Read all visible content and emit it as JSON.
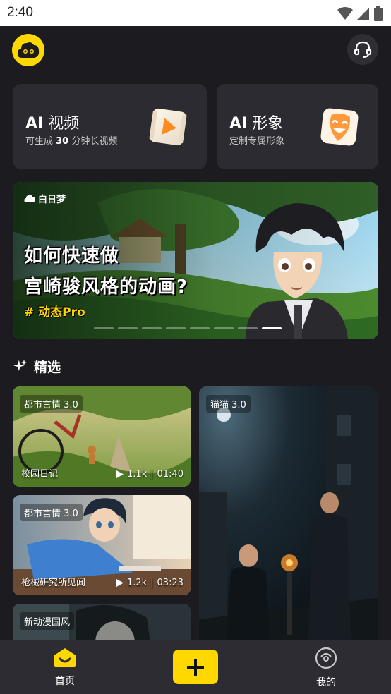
{
  "status": {
    "time": "2:40"
  },
  "header": {
    "logo_icon": "cloud-face-logo",
    "support_icon": "headset-icon"
  },
  "features": [
    {
      "title_prefix": "AI",
      "title_suffix": " 视频",
      "sub_a": "可生成 ",
      "sub_num": "30",
      "sub_b": " 分钟长视频",
      "icon": "play-icon"
    },
    {
      "title_prefix": "AI",
      "title_suffix": " 形象",
      "sub": "定制专属形象",
      "icon": "smile-mask-icon"
    }
  ],
  "banner": {
    "brand": "白日梦",
    "headline_1": "如何快速做",
    "headline_2": "宫崎骏风格的动画?",
    "tag": "# 动态Pro",
    "slides": 8,
    "active_slide": 8
  },
  "section": {
    "title": "精选",
    "icon": "sparkle-icon"
  },
  "cards": [
    {
      "tag": "都市言情 3.0",
      "title": "校园日记",
      "views": "1.1k",
      "duration": "01:40"
    },
    {
      "tag": "猫猫 3.0"
    },
    {
      "tag": "都市言情 3.0",
      "title": "枪械研究所见闻",
      "views": "1.2k",
      "duration": "03:23"
    },
    {
      "tag": "新动漫国风"
    }
  ],
  "nav": {
    "home_label": "首页",
    "create_icon": "plus-icon",
    "mine_label": "我的"
  },
  "colors": {
    "accent": "#ffd800",
    "background": "#1b1b20",
    "card": "#2b2b31"
  }
}
